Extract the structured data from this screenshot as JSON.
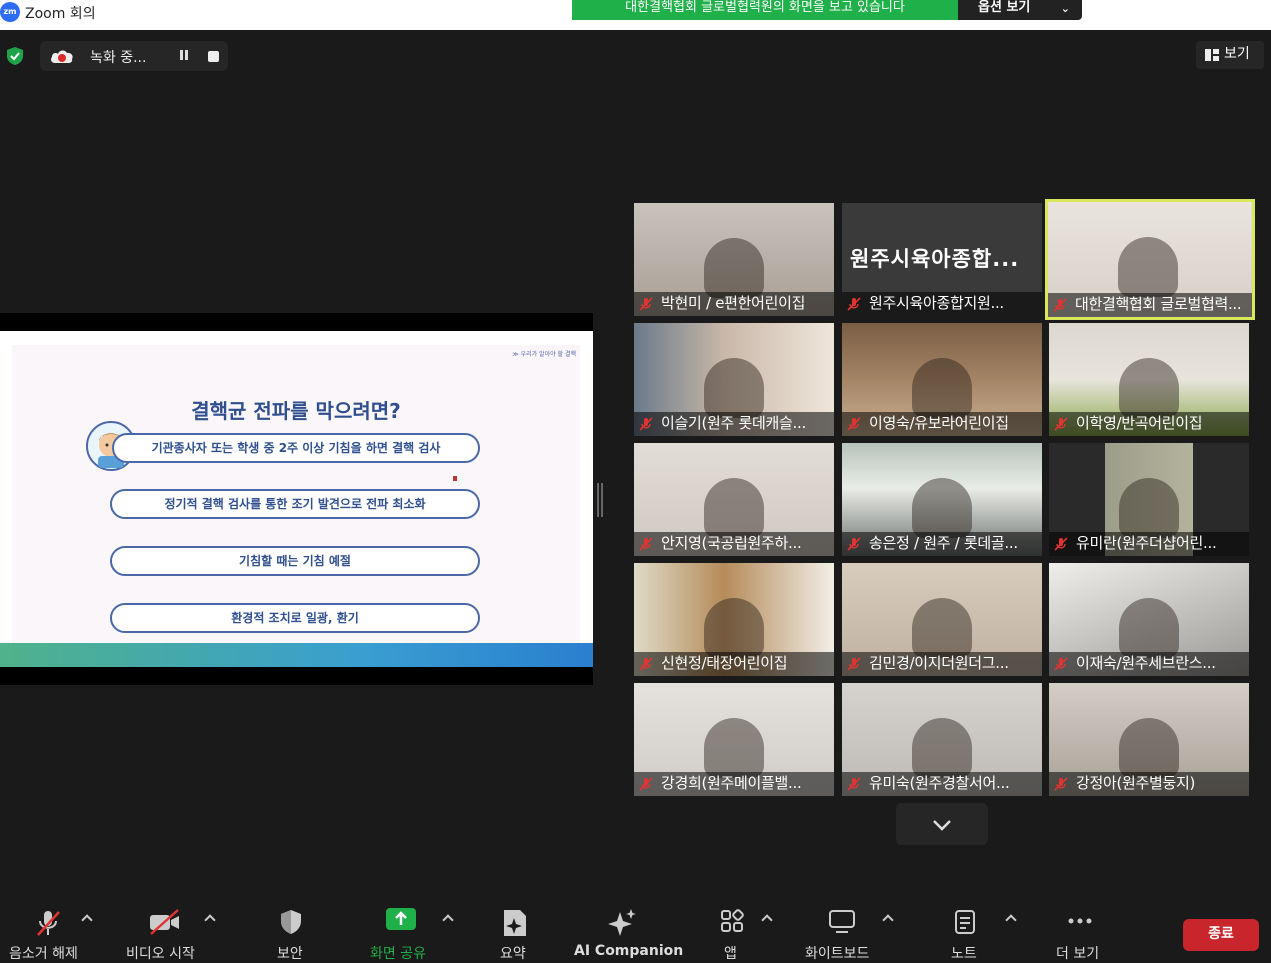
{
  "window": {
    "logo": "zm",
    "title": "Zoom 회의"
  },
  "banner": {
    "share_text": "대한결핵협회 글로벌협력원의 화면을 보고 있습니다",
    "options_label": "옵션 보기"
  },
  "recording": {
    "status": "녹화 중..."
  },
  "view": {
    "label": "보기"
  },
  "slide": {
    "crumb": "≫ 우리가 알아야 할 결핵",
    "title": "결핵균 전파를 막으려면?",
    "items": [
      "기관종사자 또는 학생 중 2주 이상 기침을 하면 결핵 검사",
      "정기적 결핵 검사를 통한 조기 발견으로 전파 최소화",
      "기침할 때는 기침 예절",
      "환경적 조치로 일광, 환기"
    ]
  },
  "participants": [
    {
      "name": "박현미 / e편한어린이집"
    },
    {
      "name": "원주시육아종합지원...",
      "tile_text": "원주시육아종합..."
    },
    {
      "name": "대한결핵협회 글로벌협력..."
    },
    {
      "name": "이슬기(원주 롯데캐슬..."
    },
    {
      "name": "이영숙/유보라어린이집"
    },
    {
      "name": "이학영/반곡어린이집"
    },
    {
      "name": "안지영(국공립원주하..."
    },
    {
      "name": "송은정 / 원주 / 롯데골..."
    },
    {
      "name": "유미란(원주더샵어린..."
    },
    {
      "name": "신현정/태장어린이집"
    },
    {
      "name": "김민경/이지더원더그..."
    },
    {
      "name": "이재숙/원주세브란스..."
    },
    {
      "name": "강경희(원주메이플밸..."
    },
    {
      "name": "유미숙(원주경찰서어..."
    },
    {
      "name": "강정아(원주별둥지)"
    }
  ],
  "toolbar": {
    "unmute": "음소거 해제",
    "start_video": "비디오 시작",
    "security": "보안",
    "share": "화면 공유",
    "summary": "요약",
    "ai_companion": "AI Companion",
    "apps": "앱",
    "whiteboard": "화이트보드",
    "notes": "노트",
    "more": "더 보기",
    "end": "종료"
  },
  "colors": {
    "share_green": "#20b04a",
    "end_red": "#c8252c",
    "active_speaker": "#d9e85a",
    "slide_blue": "#2f4f8f"
  }
}
